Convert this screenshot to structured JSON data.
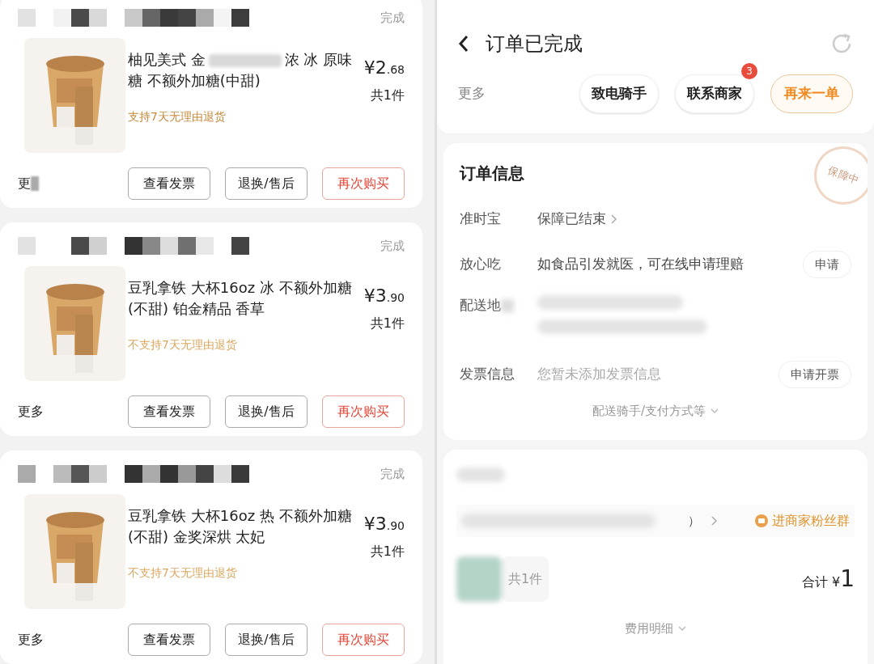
{
  "orders": [
    {
      "status": "完成",
      "title_start": "柚见美式 金",
      "title_redacted": true,
      "title_end": "浓 冰 原味糖 不额外加糖(中甜)",
      "return_policy": "支持7天无理由退货",
      "returnable": true,
      "price_int": "¥2",
      "price_dec": ".68",
      "count": "共1件",
      "more": "更",
      "more_redacted": true,
      "buttons": [
        {
          "label": "查看发票",
          "primary": false
        },
        {
          "label": "退换/售后",
          "primary": false
        },
        {
          "label": "再次购买",
          "primary": true
        }
      ]
    },
    {
      "status": "完成",
      "title_start": "豆乳拿铁 大杯16oz 冰 不额外加糖(不甜) 铂金精品 香草",
      "return_policy": "不支持7天无理由退货",
      "returnable": false,
      "price_int": "¥3",
      "price_dec": ".90",
      "count": "共1件",
      "more": "更多",
      "buttons": [
        {
          "label": "查看发票",
          "primary": false
        },
        {
          "label": "退换/售后",
          "primary": false
        },
        {
          "label": "再次购买",
          "primary": true
        }
      ]
    },
    {
      "status": "完成",
      "title_start": "豆乳拿铁 大杯16oz 热 不额外加糖(不甜) 金奖深烘 太妃",
      "return_policy": "不支持7天无理由退货",
      "returnable": false,
      "price_int": "¥3",
      "price_dec": ".90",
      "count": "共1件",
      "more": "更多",
      "buttons": [
        {
          "label": "查看发票",
          "primary": false
        },
        {
          "label": "退换/售后",
          "primary": false
        },
        {
          "label": "再次购买",
          "primary": true
        }
      ]
    }
  ],
  "detail": {
    "title": "订单已完成",
    "more": "更多",
    "actions": [
      {
        "label": "致电骑手",
        "primary": false
      },
      {
        "label": "联系商家",
        "primary": false,
        "badge": "3"
      },
      {
        "label": "再来一单",
        "primary": true
      }
    ],
    "info_title": "订单信息",
    "stamp": "保障中",
    "rows": [
      {
        "kind": "link",
        "label": "准时宝",
        "value": "保障已结束"
      },
      {
        "kind": "button",
        "label": "放心吃",
        "value": "如食品引发就医，可在线申请理赔",
        "button": "申请"
      },
      {
        "kind": "redacted",
        "label": "配送地"
      },
      {
        "kind": "button",
        "label": "发票信息",
        "value": "您暂未添加发票信息",
        "button": "申请开票",
        "muted": true
      }
    ],
    "expand": "配送骑手/支付方式等",
    "fragment": "）",
    "fan_group": "进商家粉丝群",
    "item_count": "共1件",
    "total_label": "合计",
    "total_currency": "¥",
    "total": "1",
    "fee_detail": "费用明细"
  }
}
